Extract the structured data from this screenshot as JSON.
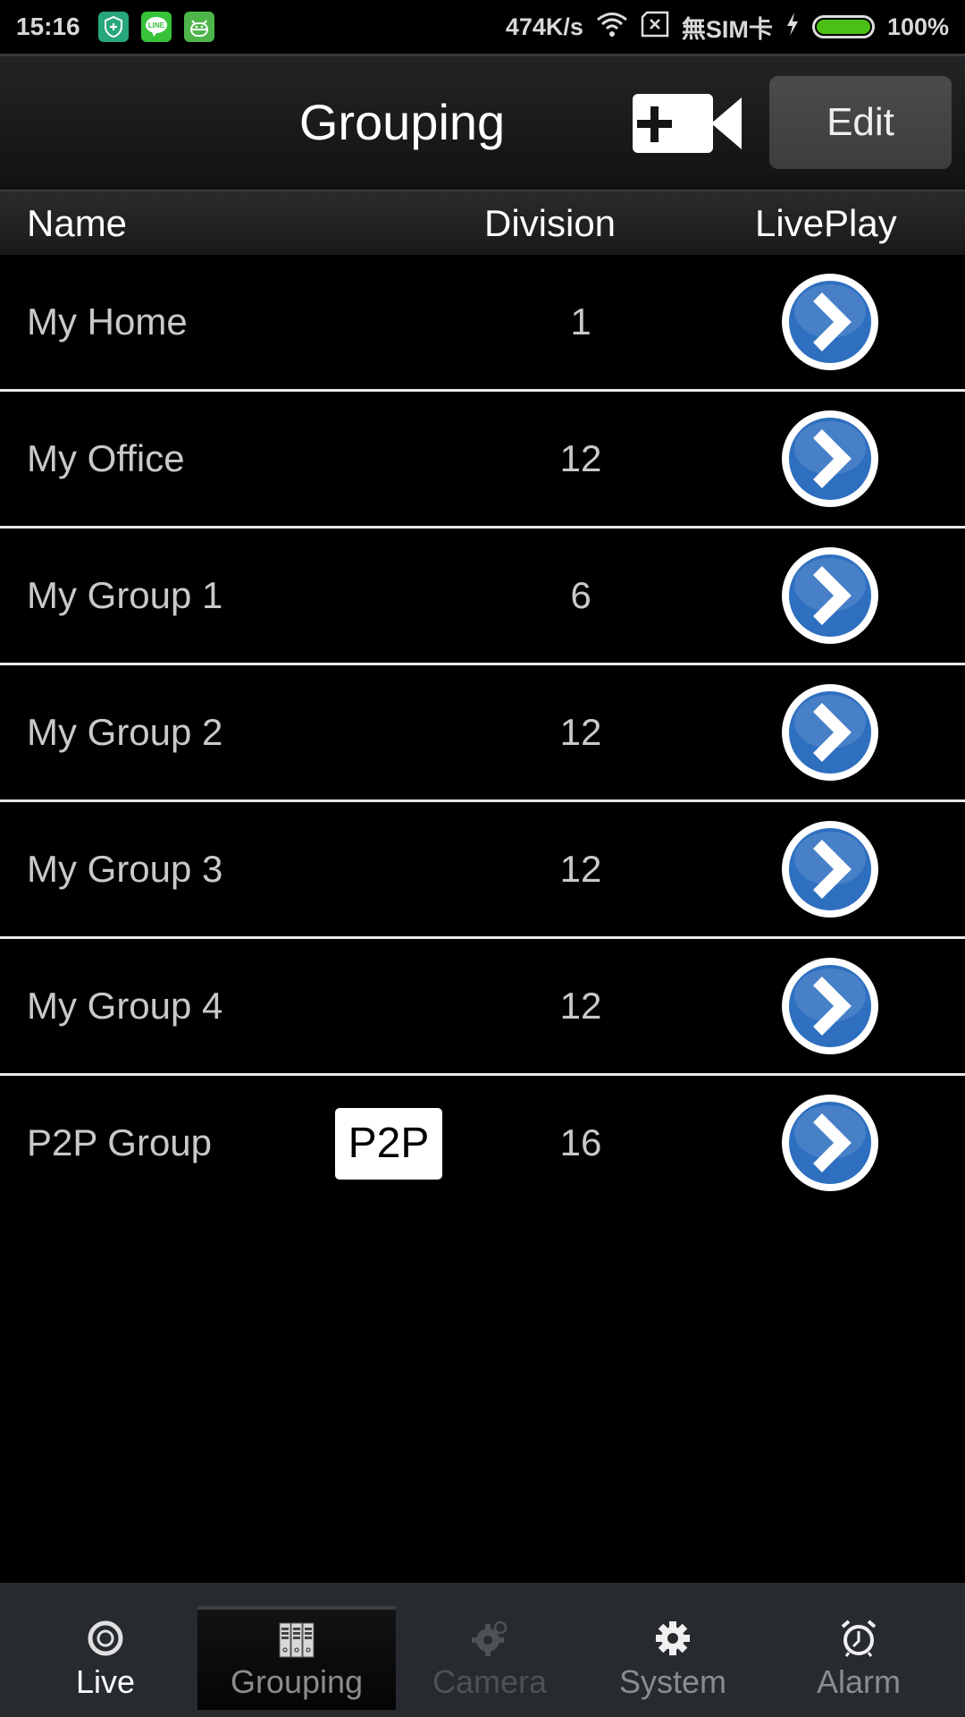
{
  "status_bar": {
    "time": "15:16",
    "notification_icons": [
      "security-shield-icon",
      "line-app-icon",
      "android-app-icon"
    ],
    "net_speed": "474K/s",
    "sim_status": "無SIM卡",
    "battery_percent": "100%",
    "battery_level": 1.0,
    "charging": true
  },
  "header": {
    "title": "Grouping",
    "add_camera_icon": "add-camera-icon",
    "edit_label": "Edit"
  },
  "columns": {
    "name": "Name",
    "division": "Division",
    "liveplay": "LivePlay"
  },
  "groups": [
    {
      "name": "My Home",
      "division": "1",
      "badge": null
    },
    {
      "name": "My Office",
      "division": "12",
      "badge": null
    },
    {
      "name": "My Group 1",
      "division": "6",
      "badge": null
    },
    {
      "name": "My Group 2",
      "division": "12",
      "badge": null
    },
    {
      "name": "My Group 3",
      "division": "12",
      "badge": null
    },
    {
      "name": "My Group 4",
      "division": "12",
      "badge": null
    },
    {
      "name": "P2P Group",
      "division": "16",
      "badge": "P2P"
    }
  ],
  "tabs": [
    {
      "label": "Live",
      "icon": "live-target-icon",
      "state": "active-white"
    },
    {
      "label": "Grouping",
      "icon": "grouping-binders-icon",
      "state": "selected"
    },
    {
      "label": "Camera",
      "icon": "camera-settings-icon",
      "state": "disabled"
    },
    {
      "label": "System",
      "icon": "gear-icon",
      "state": "normal"
    },
    {
      "label": "Alarm",
      "icon": "alarm-clock-icon",
      "state": "normal"
    }
  ],
  "colors": {
    "accent_blue": "#2e6fc0",
    "battery_green": "#4cbf14"
  }
}
